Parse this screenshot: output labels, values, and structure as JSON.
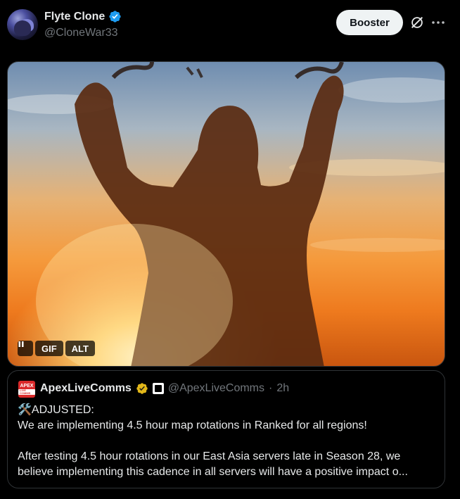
{
  "author": {
    "display_name": "Flyte Clone",
    "handle": "@CloneWar33",
    "verified_badge": "blue-verified-icon"
  },
  "actions": {
    "booster_label": "Booster",
    "grok_icon": "grok-icon",
    "more_icon": "more-horizontal-icon"
  },
  "media": {
    "type": "gif",
    "pause_icon": "pause-icon",
    "gif_label": "GIF",
    "alt_label": "ALT"
  },
  "quote": {
    "avatar_text": "APEX",
    "avatar_sub": "LIVE COMMS",
    "display_name": "ApexLiveComms",
    "handle": "@ApexLiveComms",
    "separator": "·",
    "time": "2h",
    "badge": "gold-verified-icon",
    "affiliate_badge": "affiliate-badge-icon",
    "lines": [
      "🛠️ADJUSTED:",
      "We are implementing 4.5 hour map rotations in Ranked for all regions!",
      "",
      "After testing 4.5 hour rotations in our East Asia servers late in Season 28, we",
      "believe implementing this cadence in all servers will have a positive impact o..."
    ]
  },
  "colors": {
    "background": "#000000",
    "text_primary": "#e7e9ea",
    "text_secondary": "#71767b",
    "verified_blue": "#1d9bf0",
    "gold_badge": "#e2b719",
    "border": "#2f3336"
  }
}
